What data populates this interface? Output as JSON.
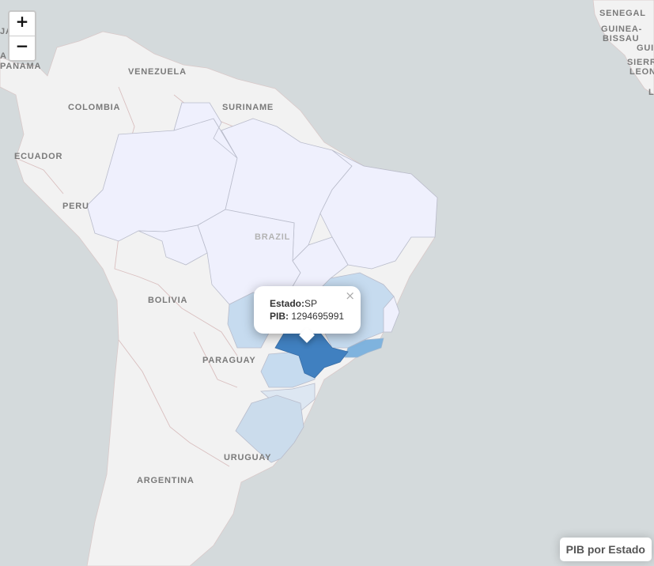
{
  "map": {
    "country_labels": [
      {
        "id": "venezuela",
        "text": "VENEZUELA"
      },
      {
        "id": "colombia",
        "text": "COLOMBIA"
      },
      {
        "id": "suriname",
        "text": "SURINAME"
      },
      {
        "id": "ecuador",
        "text": "ECUADOR"
      },
      {
        "id": "peru",
        "text": "PERU"
      },
      {
        "id": "brazil",
        "text": "BRAZIL"
      },
      {
        "id": "bolivia",
        "text": "BOLIVIA"
      },
      {
        "id": "paraguay",
        "text": "PARAGUAY"
      },
      {
        "id": "uruguay",
        "text": "URUGUAY"
      },
      {
        "id": "argentina",
        "text": "ARGENTINA"
      },
      {
        "id": "panama",
        "text": "PANAMA"
      },
      {
        "id": "senegal",
        "text": "SENEGAL"
      },
      {
        "id": "guinea_bissau_1",
        "text": "GUINEA-"
      },
      {
        "id": "guinea_bissau_2",
        "text": "BISSAU"
      },
      {
        "id": "guinea",
        "text": "GUI"
      },
      {
        "id": "sierra_1",
        "text": "SIERR"
      },
      {
        "id": "sierra_2",
        "text": "LEON"
      },
      {
        "id": "edge_ja",
        "text": "JA"
      },
      {
        "id": "edge_a",
        "text": "A"
      },
      {
        "id": "edge_l",
        "text": "L"
      }
    ],
    "colors": {
      "ocean": "#d4dadc",
      "land": "#f2f2f2",
      "brazil_low": "#eff0fd",
      "mg_ms_pr": "#c6dbef",
      "rs": "#cbdcec",
      "rj": "#7fb3de",
      "sp": "#4080c0"
    }
  },
  "zoom": {
    "in_label": "+",
    "out_label": "−"
  },
  "popup": {
    "estado_label": "Estado:",
    "estado_value": "SP",
    "pib_label": "PIB:",
    "pib_value": "1294695991",
    "close_label": "×"
  },
  "legend": {
    "title": "PIB por Estado"
  }
}
